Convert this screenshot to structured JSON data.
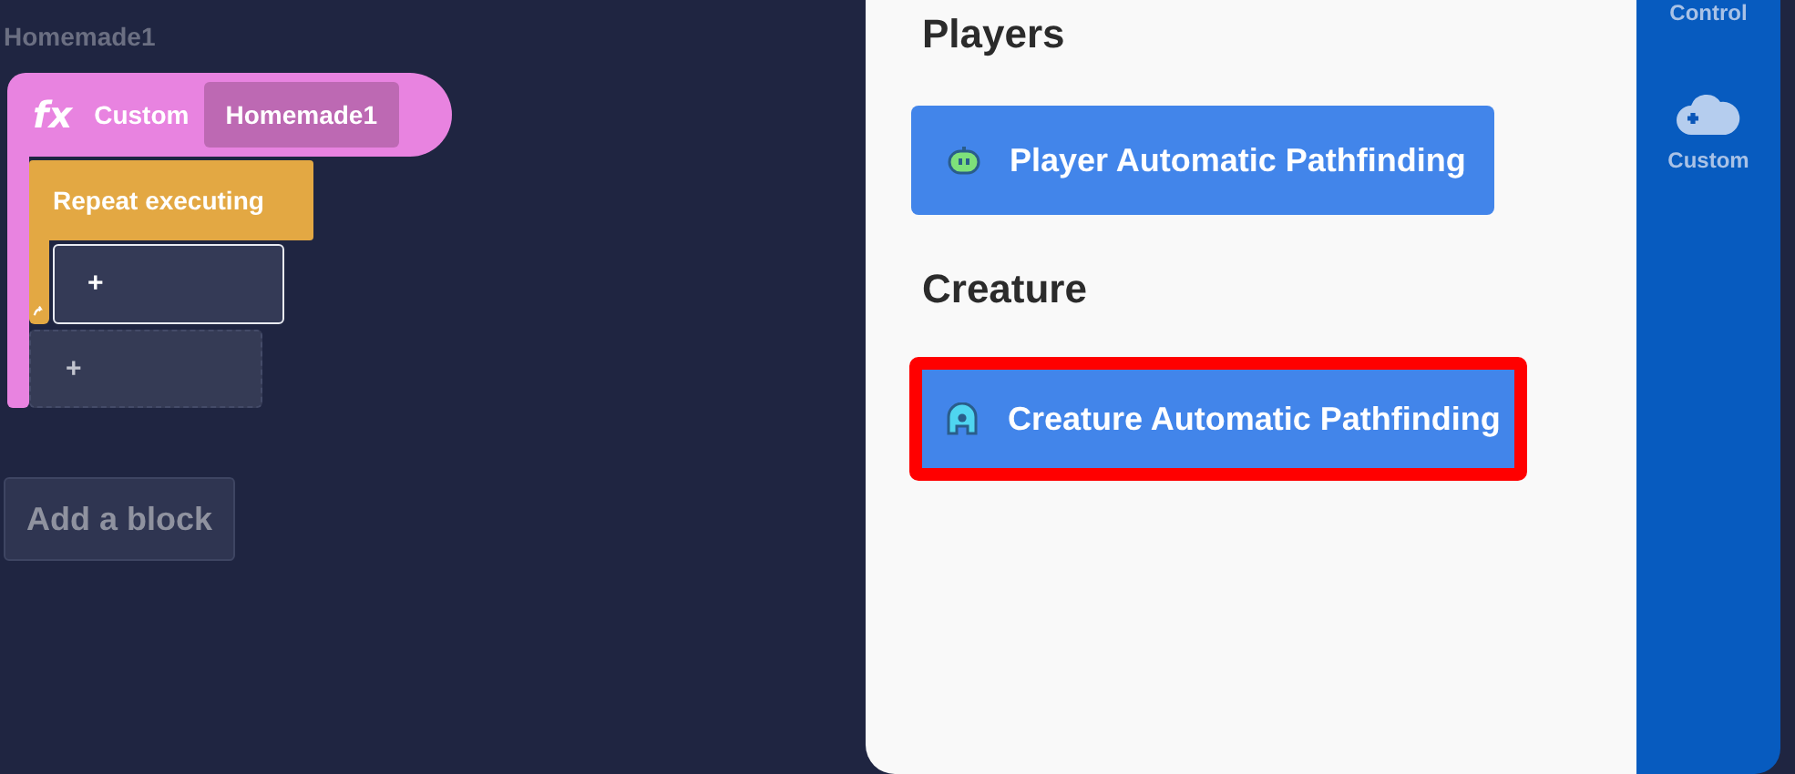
{
  "canvas": {
    "title": "Homemade1",
    "custom_block": {
      "icon_text": "fx",
      "label": "Custom",
      "name_field": "Homemade1"
    },
    "repeat_block": {
      "label": "Repeat executing",
      "inner_slot": {
        "text": "+",
        "selected": true
      }
    },
    "next_slot": {
      "text": "+",
      "selected": false
    },
    "add_button": "Add a block"
  },
  "panel": {
    "sections": [
      {
        "heading": "Players",
        "items": [
          {
            "label": "Player Automatic Pathfinding",
            "kind": "player",
            "highlighted": false
          }
        ]
      },
      {
        "heading": "Creature",
        "items": [
          {
            "label": "Creature Automatic Pathfinding",
            "kind": "creature",
            "highlighted": true
          }
        ]
      }
    ]
  },
  "sidebar": {
    "items": [
      {
        "label": "Control",
        "kind": "cut"
      },
      {
        "label": "Custom",
        "kind": "custom"
      }
    ]
  }
}
